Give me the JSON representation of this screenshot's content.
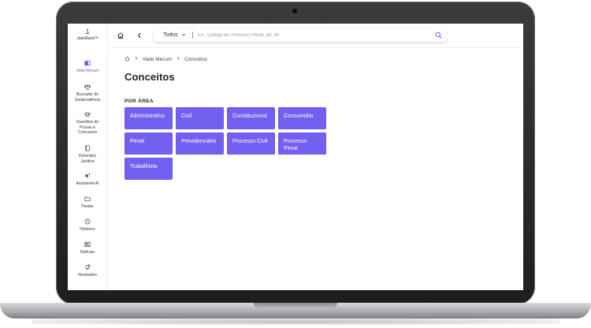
{
  "colors": {
    "accent": "#7460f0",
    "active_nav": "#6d5cf0",
    "text": "#222222"
  },
  "logo": {
    "text": "JurisRand™"
  },
  "sidebar": {
    "items": [
      {
        "label": "Vade Mecum",
        "icon": "book-icon",
        "active": true
      },
      {
        "label": "Buscador de Jurisprudência",
        "icon": "scales-icon"
      },
      {
        "label": "Questões de Provas e Concursos",
        "icon": "graduation-cap-icon"
      },
      {
        "label": "Dicionário Jurídico",
        "icon": "dictionary-icon"
      },
      {
        "label": "Assistente AI",
        "icon": "sparkle-icon"
      },
      {
        "label": "Pastas",
        "icon": "folder-icon"
      },
      {
        "label": "Histórico",
        "icon": "history-icon"
      },
      {
        "label": "Notícias",
        "icon": "news-icon"
      },
      {
        "label": "Novidades",
        "icon": "bell-icon"
      }
    ]
  },
  "search": {
    "scope": "Todos",
    "placeholder": "Ex.: Código de Processo Penal, art. 49",
    "value": ""
  },
  "breadcrumb": {
    "items": [
      "Vade Mecum",
      "Conceitos"
    ]
  },
  "page": {
    "title": "Conceitos",
    "section_label": "POR ÁREA",
    "areas": [
      "Administrativo",
      "Civil",
      "Constitucional",
      "Consumidor",
      "Penal",
      "Previdenciário",
      "Processo Civil",
      "Processo Penal",
      "Trabalhista"
    ]
  }
}
